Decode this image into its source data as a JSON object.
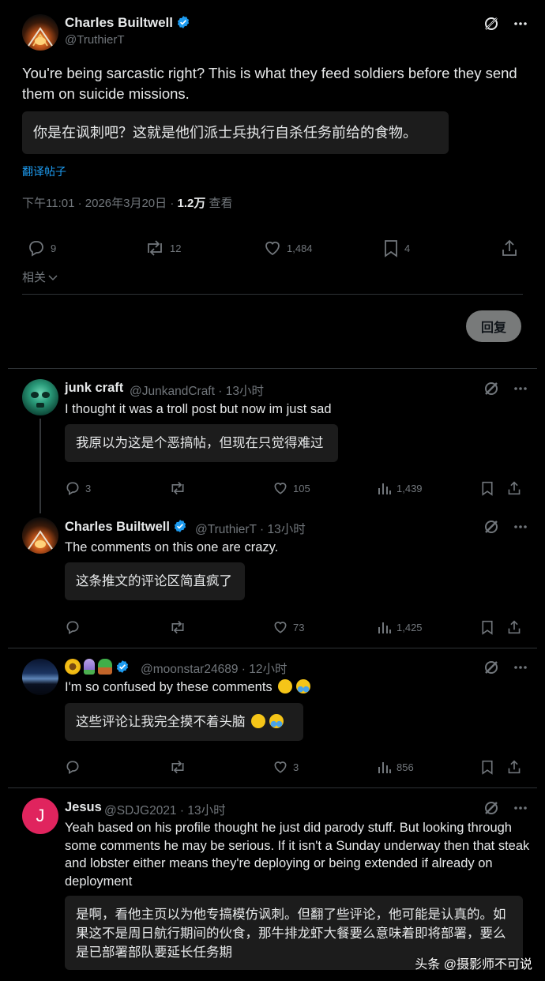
{
  "main_post": {
    "author": "Charles Builtwell",
    "handle": "@TruthierT",
    "text": "You're being sarcastic right? This is what they feed soldiers before they send them on suicide missions.",
    "translation": "你是在讽刺吧？这就是他们派士兵执行自杀任务前给的食物。",
    "translate_link": "翻译帖子",
    "timestamp": "下午11:01 · 2026年3月20日 · ",
    "views_count": "1.2万",
    "views_label": " 查看",
    "replies": "9",
    "reposts": "12",
    "likes": "1,484",
    "bookmarks": "4",
    "related_label": "相关"
  },
  "reply_button": "回复",
  "replies": [
    {
      "author": "junk craft",
      "handle": "@JunkandCraft · 13小时",
      "text": "I thought it was a troll post but now im just sad",
      "translation": "我原以为这是个恶搞帖，但现在只觉得难过",
      "replies": "3",
      "reposts": "",
      "likes": "105",
      "views": "1,439"
    },
    {
      "author": "Charles Builtwell",
      "handle": "@TruthierT · 13小时",
      "text": "The comments on this one are crazy.",
      "translation": "这条推文的评论区简直疯了",
      "replies": "",
      "reposts": "",
      "likes": "73",
      "views": "1,425"
    },
    {
      "author": "",
      "handle": "@moonstar24689 · 12小时",
      "text": "I'm so confused by these comments",
      "translation": "这些评论让我完全摸不着头脑",
      "replies": "",
      "reposts": "",
      "likes": "3",
      "views": "856"
    },
    {
      "author": "Jesus",
      "avatar_letter": "J",
      "handle": "@SDJG2021 · 13小时",
      "text": "Yeah based on his profile thought he just did parody stuff. But looking through some comments he may be serious. If it isn't a Sunday underway then that steak and lobster either means they're deploying or being extended if already on deployment",
      "translation": "是啊，看他主页以为他专搞模仿讽刺。但翻了些评论，他可能是认真的。如果这不是周日航行期间的伙食，那牛排龙虾大餐要么意味着即将部署，要么是已部署部队要延长任务期"
    }
  ],
  "watermark": "头条 @摄影师不可说",
  "colors": {
    "background": "#000000",
    "text": "#e7e9ea",
    "muted": "#71767b",
    "link": "#1d9bf0",
    "verified": "#1d9bf0",
    "translation_bg": "#1c1c1c",
    "divider": "#2f3336",
    "avatar_j": "#e0245e"
  }
}
